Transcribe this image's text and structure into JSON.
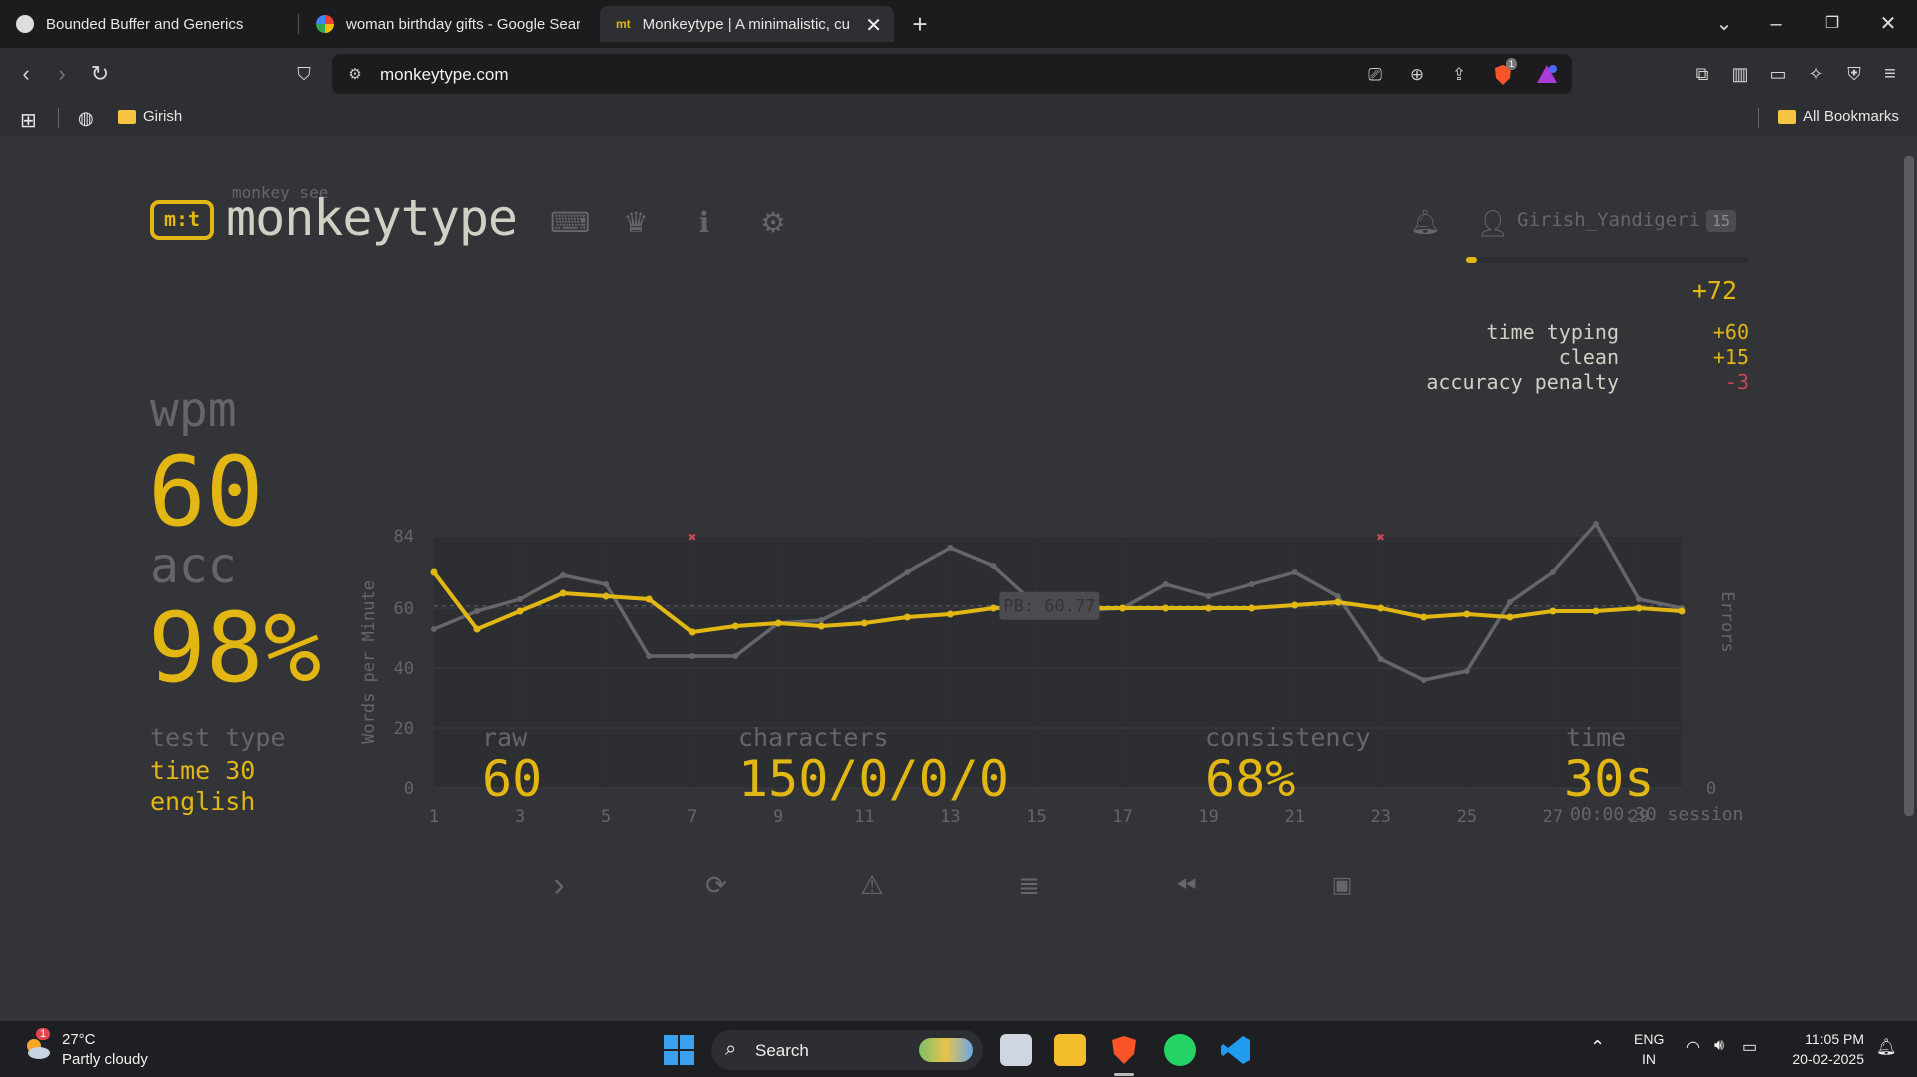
{
  "browser": {
    "tabs": [
      {
        "title": "Bounded Buffer and Generics",
        "active": false
      },
      {
        "title": "woman birthday gifts - Google Sear",
        "active": false
      },
      {
        "title": "Monkeytype | A minimalistic, cu",
        "active": true
      }
    ],
    "url": "monkeytype.com",
    "bookmarks": {
      "folder": "Girish",
      "all": "All Bookmarks"
    },
    "brave_badge": "1"
  },
  "site": {
    "logo_sub": "monkey see",
    "logo_title": "monkeytype",
    "username": "Girish_Yandigeri",
    "level": "15",
    "xp_fill": 0.04
  },
  "xp": {
    "total": "+72",
    "rows": [
      {
        "label": "time typing",
        "value": "+60"
      },
      {
        "label": "clean",
        "value": "+15"
      },
      {
        "label": "accuracy penalty",
        "value": "-3"
      }
    ]
  },
  "result": {
    "wpm_label": "wpm",
    "wpm": "60",
    "acc_label": "acc",
    "acc": "98%",
    "test_type_label": "test type",
    "test_type_1": "time 30",
    "test_type_2": "english",
    "raw_label": "raw",
    "raw": "60",
    "characters_label": "characters",
    "characters": "150/0/0/0",
    "consistency_label": "consistency",
    "consistency": "68%",
    "time_label": "time",
    "time": "30s",
    "session": "00:00:30 session"
  },
  "chart_data": {
    "type": "line",
    "ylabel": "Words per Minute",
    "y2label": "Errors",
    "ylim": [
      0,
      84
    ],
    "yticks": [
      "0",
      "20",
      "40",
      "60",
      "84"
    ],
    "y2ticks": [
      "0"
    ],
    "xticks": [
      "1",
      "3",
      "5",
      "7",
      "9",
      "11",
      "13",
      "15",
      "17",
      "19",
      "21",
      "23",
      "25",
      "27",
      "29"
    ],
    "x": [
      1,
      2,
      3,
      4,
      5,
      6,
      7,
      8,
      9,
      10,
      11,
      12,
      13,
      14,
      15,
      16,
      17,
      18,
      19,
      20,
      21,
      22,
      23,
      24,
      25,
      26,
      27,
      28,
      29,
      30
    ],
    "pb": {
      "label": "PB: 60.77",
      "value": 60.77
    },
    "series": [
      {
        "name": "",
        "color": "#e2b714",
        "values": [
          72,
          53,
          59,
          65,
          64,
          63,
          52,
          54,
          55,
          54,
          55,
          57,
          58,
          60,
          60,
          60,
          60,
          60,
          60,
          60,
          61,
          62,
          60,
          57,
          58,
          57,
          59,
          59,
          60,
          59
        ]
      },
      {
        "name": "",
        "color": "#646669",
        "values": [
          53,
          59,
          63,
          71,
          68,
          44,
          44,
          44,
          55,
          56,
          63,
          72,
          80,
          74,
          61,
          59,
          60,
          68,
          64,
          68,
          72,
          64,
          43,
          36,
          39,
          62,
          72,
          88,
          63,
          60
        ]
      }
    ],
    "errors_at": [
      7,
      23
    ]
  },
  "footer_icons": [
    "next-test-icon",
    "restart-icon",
    "report-icon",
    "words-history-icon",
    "replay-icon",
    "screenshot-icon"
  ],
  "taskbar": {
    "weather_temp": "27°C",
    "weather_text": "Partly cloudy",
    "weather_badge": "1",
    "search": "Search",
    "lang1": "ENG",
    "lang2": "IN",
    "time": "11:05 PM",
    "date": "20-02-2025"
  }
}
